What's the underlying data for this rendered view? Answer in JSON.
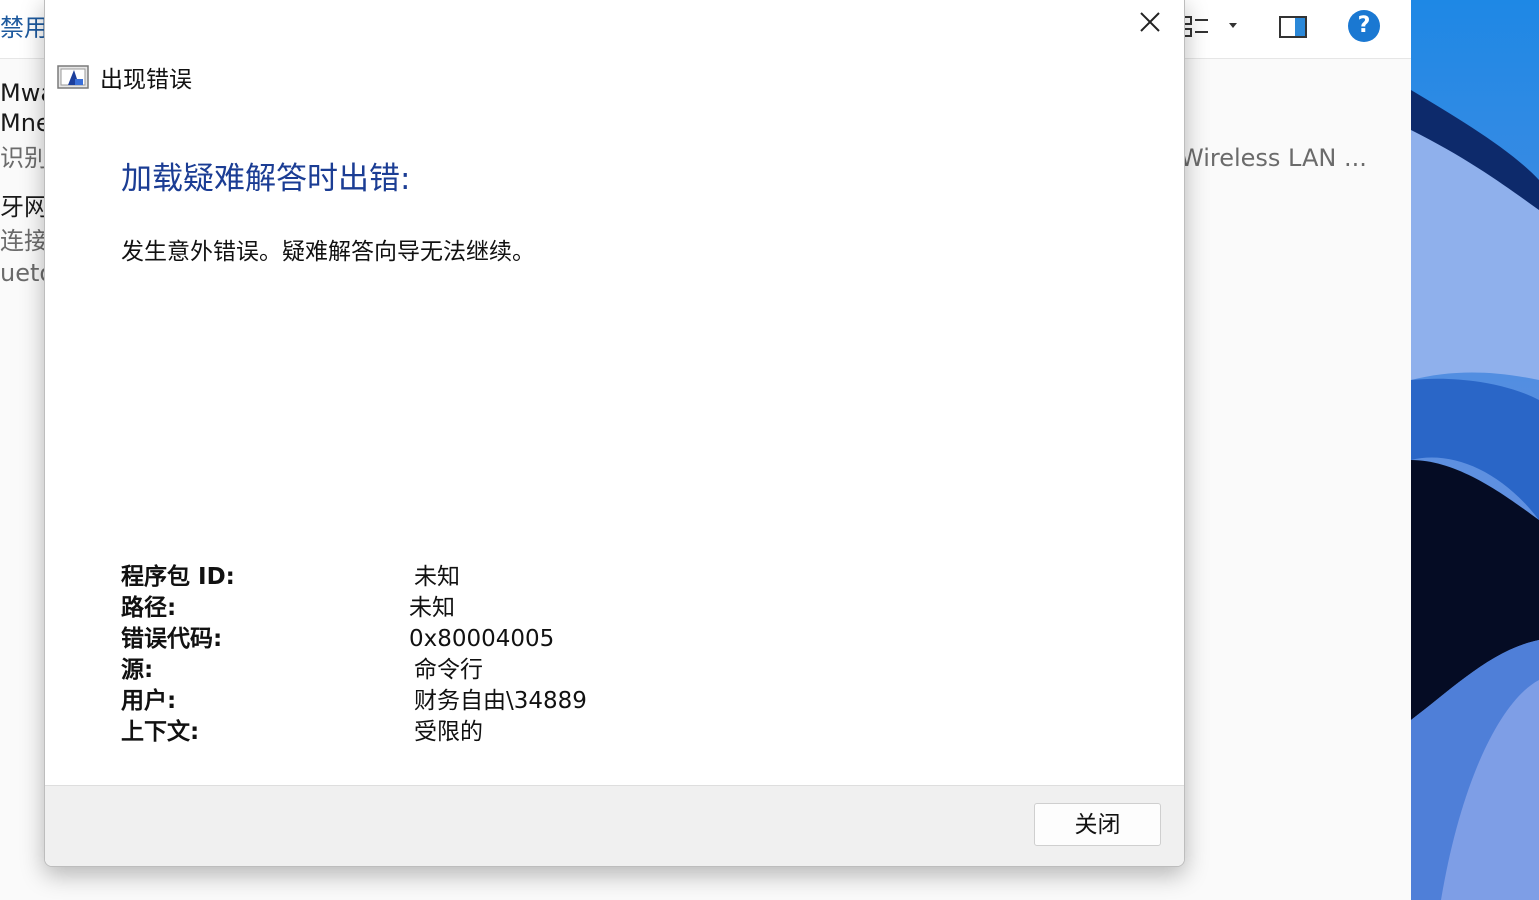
{
  "background_window": {
    "disable_label": "禁用",
    "items": [
      {
        "name": "Mwa",
        "sub": "Mne",
        "status": "识别"
      },
      {
        "name": "牙网",
        "status": "连接",
        "device": "ueto"
      }
    ],
    "wireless_label": "Wireless LAN ...",
    "toolbar": {
      "view_icon": "view-options-icon",
      "pane_icon": "preview-pane-icon",
      "help_label": "?"
    }
  },
  "dialog": {
    "title": "出现错误",
    "heading": "加载疑难解答时出错:",
    "message": "发生意外错误。疑难解答向导无法继续。",
    "details": [
      {
        "label": "程序包 ID:",
        "value": "未知"
      },
      {
        "label": "路径:",
        "value": "未知"
      },
      {
        "label": "错误代码:",
        "value": "0x80004005"
      },
      {
        "label": "源:",
        "value": "命令行"
      },
      {
        "label": "用户:",
        "value": "财务自由\\34889"
      },
      {
        "label": "上下文:",
        "value": "受限的"
      }
    ],
    "close_button_label": "关闭"
  },
  "colors": {
    "heading": "#1b3d94",
    "help_accent": "#1a78d2"
  }
}
